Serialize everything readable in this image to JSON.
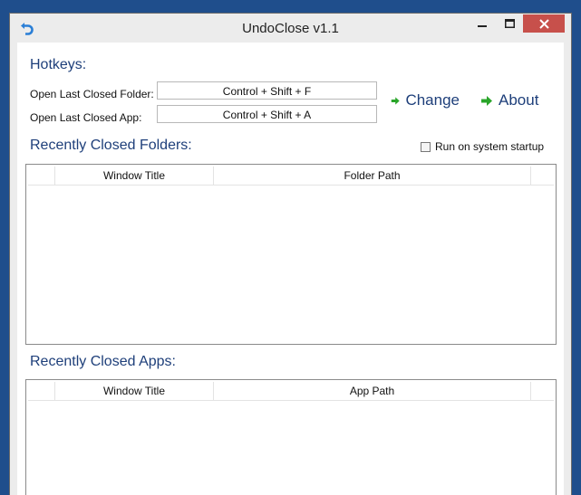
{
  "window": {
    "title": "UndoClose v1.1"
  },
  "hotkeys": {
    "heading": "Hotkeys:",
    "folder_label": "Open Last Closed Folder:",
    "folder_value": "Control + Shift + F",
    "app_label": "Open Last Closed App:",
    "app_value": "Control + Shift + A",
    "change_label": "Change",
    "about_label": "About"
  },
  "folders": {
    "heading": "Recently Closed Folders:",
    "startup_label": "Run on system startup",
    "startup_checked": false,
    "columns": [
      "",
      "Window Title",
      "Folder Path",
      ""
    ],
    "rows": []
  },
  "apps": {
    "heading": "Recently Closed Apps:",
    "columns": [
      "",
      "Window Title",
      "App Path",
      ""
    ],
    "rows": []
  },
  "icons": {
    "app": "undo-arrow-icon",
    "arrow": "green-arrow-right-icon",
    "minimize": "minimize-icon",
    "maximize": "maximize-icon",
    "close": "close-icon"
  },
  "colors": {
    "heading": "#1e3f7a",
    "accent_green": "#2aa52a",
    "close_button": "#c7504b",
    "desktop": "#1f4e8c"
  }
}
